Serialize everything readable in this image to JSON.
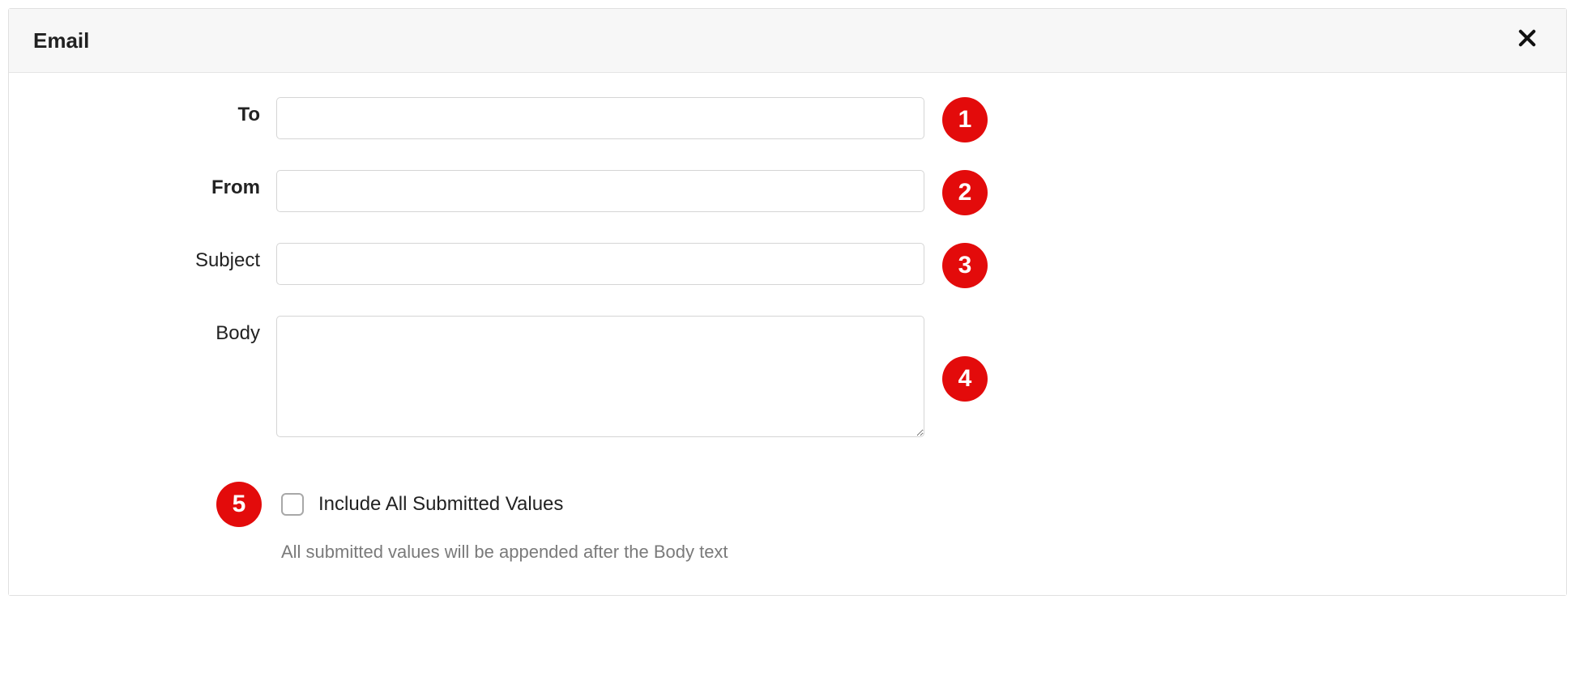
{
  "panel": {
    "title": "Email"
  },
  "form": {
    "to": {
      "label": "To",
      "value": ""
    },
    "from": {
      "label": "From",
      "value": ""
    },
    "subject": {
      "label": "Subject",
      "value": ""
    },
    "body": {
      "label": "Body",
      "value": ""
    },
    "include_all": {
      "label": "Include All Submitted Values",
      "checked": false,
      "help": "All submitted values will be appended after the Body text"
    }
  },
  "annotations": {
    "to": "1",
    "from": "2",
    "subject": "3",
    "body": "4",
    "include_all": "5"
  }
}
